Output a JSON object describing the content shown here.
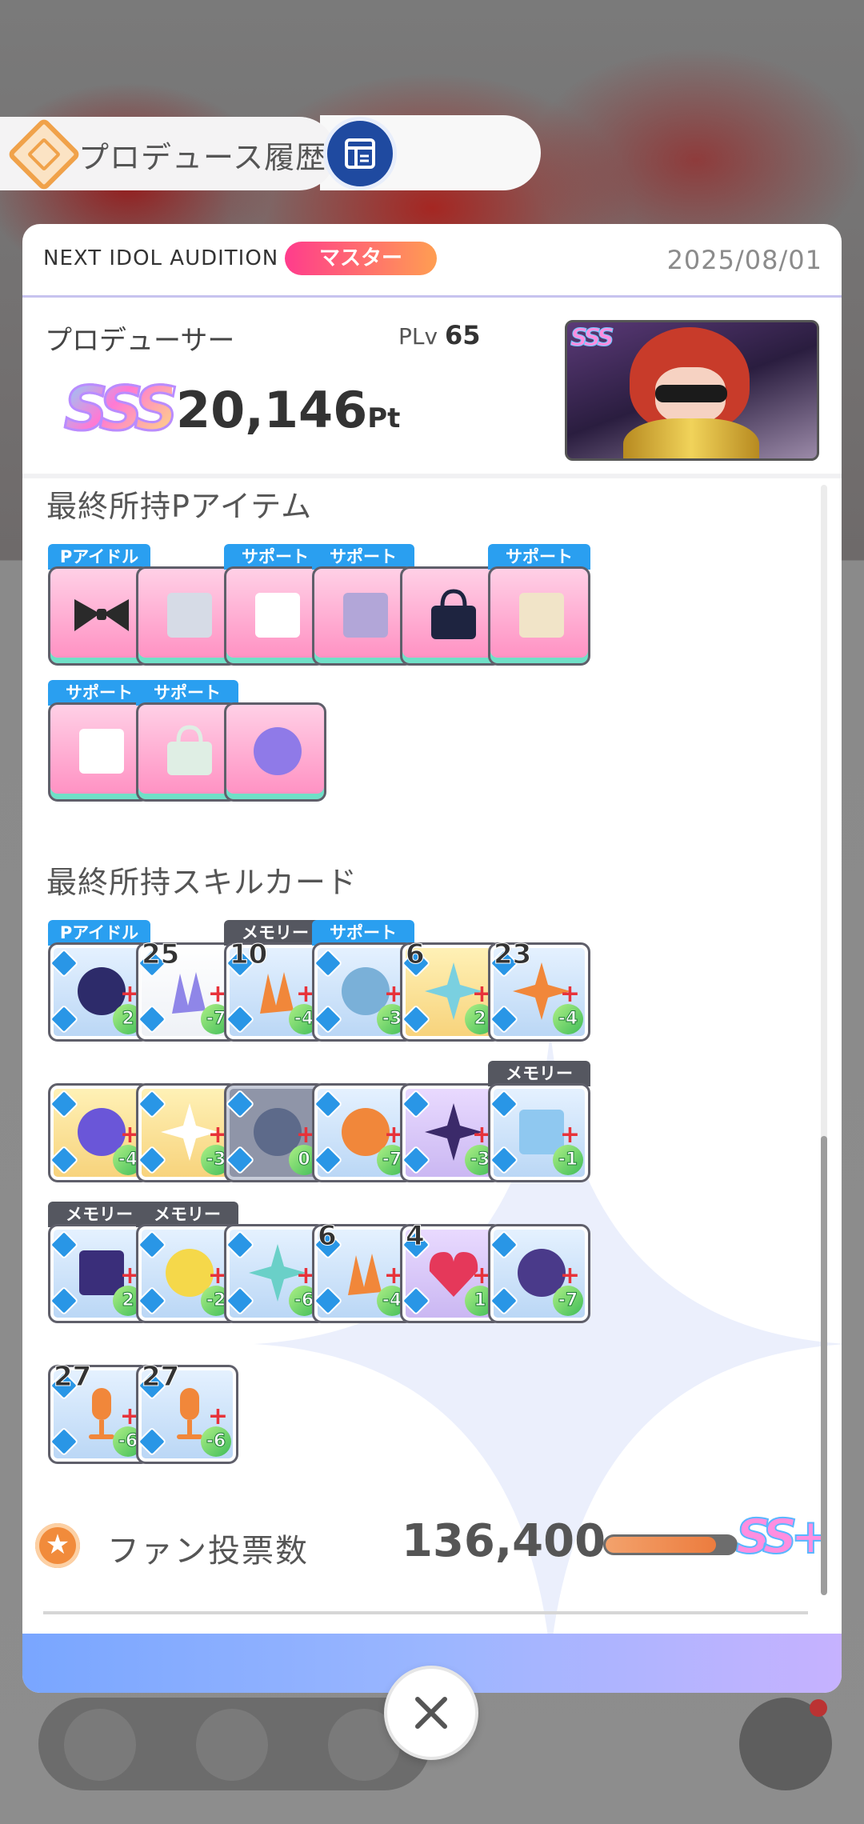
{
  "header": {
    "history_label": "プロデュース履歴"
  },
  "audition": {
    "name": "NEXT IDOL AUDITION",
    "rank_badge": "マスター",
    "date": "2025/08/01"
  },
  "producer": {
    "label": "プロデューサー",
    "plv_prefix": "PLv",
    "plv_value": "65",
    "rank": "SSS",
    "score": "20,146",
    "score_unit": "Pt",
    "portrait_rank": "SSS"
  },
  "p_items": {
    "title": "最終所持Pアイテム",
    "items": [
      {
        "tag": "Pアイドル",
        "icon": "black-ribbon-icon"
      },
      {
        "tag": "",
        "icon": "nia-bag-icon"
      },
      {
        "tag": "サポート",
        "icon": "handkerchief-icon"
      },
      {
        "tag": "サポート",
        "icon": "photo-frame-icon"
      },
      {
        "tag": "",
        "icon": "nia-tote-bag-icon"
      },
      {
        "tag": "サポート",
        "icon": "ramen-book-icon"
      },
      {
        "tag": "サポート",
        "icon": "flower-card-icon"
      },
      {
        "tag": "サポート",
        "icon": "shopping-bag-icon"
      },
      {
        "tag": "",
        "icon": "crystal-trophy-icon"
      }
    ]
  },
  "skill_cards": {
    "title": "最終所持スキルカード",
    "cards": [
      {
        "tag": "Pアイドル",
        "level": "",
        "cost": "2",
        "icon": "idol-portrait-card"
      },
      {
        "tag": "",
        "level": "25",
        "cost": "-7",
        "icon": "fist-card"
      },
      {
        "tag": "メモリー",
        "level": "10",
        "cost": "-4",
        "icon": "clap-hands-card"
      },
      {
        "tag": "サポート",
        "level": "",
        "cost": "-3",
        "icon": "support-photo-card"
      },
      {
        "tag": "",
        "level": "6",
        "cost": "2",
        "icon": "idea-sparkle-card"
      },
      {
        "tag": "",
        "level": "23",
        "cost": "-4",
        "icon": "crane-card"
      },
      {
        "tag": "",
        "level": "",
        "cost": "-4",
        "icon": "light-orb-card"
      },
      {
        "tag": "",
        "level": "",
        "cost": "-3",
        "icon": "sparkle-star-card"
      },
      {
        "tag": "",
        "level": "",
        "cost": "0",
        "icon": "stopwatch-card"
      },
      {
        "tag": "",
        "level": "",
        "cost": "-7",
        "icon": "handshake-card"
      },
      {
        "tag": "",
        "level": "",
        "cost": "-3",
        "icon": "dark-wing-card"
      },
      {
        "tag": "メモリー",
        "level": "",
        "cost": "-1",
        "icon": "stage-memory-card"
      },
      {
        "tag": "メモリー",
        "level": "",
        "cost": "2",
        "icon": "stage-lights-card"
      },
      {
        "tag": "メモリー",
        "level": "",
        "cost": "-2",
        "icon": "mascot-card"
      },
      {
        "tag": "",
        "level": "",
        "cost": "-6",
        "icon": "keys-card"
      },
      {
        "tag": "",
        "level": "6",
        "cost": "-4",
        "icon": "clap-hands-card"
      },
      {
        "tag": "",
        "level": "4",
        "cost": "1",
        "icon": "heart-card"
      },
      {
        "tag": "",
        "level": "",
        "cost": "-7",
        "icon": "dancer-card"
      },
      {
        "tag": "",
        "level": "27",
        "cost": "-6",
        "icon": "microphone-card"
      },
      {
        "tag": "",
        "level": "27",
        "cost": "-6",
        "icon": "microphone-card"
      }
    ]
  },
  "fan_votes": {
    "label": "ファン投票数",
    "value": "136,400",
    "progress": 0.85,
    "rank": "SS+"
  },
  "colors": {
    "accent_blue": "#2a9ff0",
    "accent_pink": "#ff3c8c",
    "accent_orange": "#f18b3b",
    "cost_green": "#3fbc58"
  }
}
